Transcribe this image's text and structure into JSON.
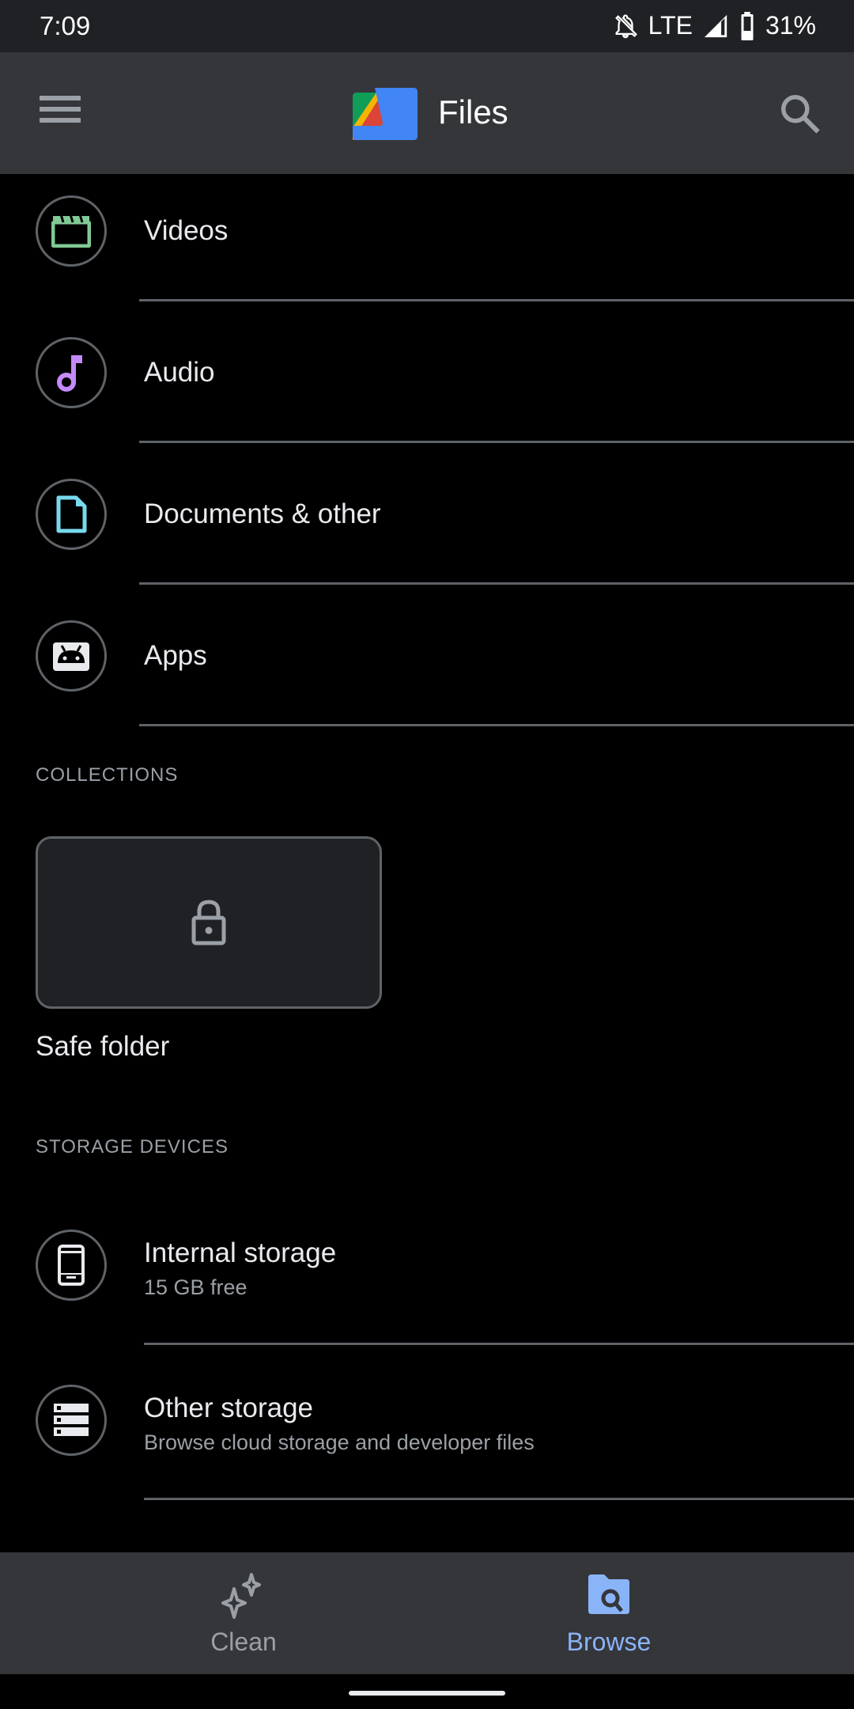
{
  "status_bar": {
    "time": "7:09",
    "network": "LTE",
    "battery": "31%"
  },
  "app_bar": {
    "title": "Files"
  },
  "categories": [
    {
      "label": "Videos",
      "icon": "video-clapper-icon",
      "color": "#81c995"
    },
    {
      "label": "Audio",
      "icon": "music-note-icon",
      "color": "#c58af9"
    },
    {
      "label": "Documents & other",
      "icon": "document-icon",
      "color": "#78d9ec"
    },
    {
      "label": "Apps",
      "icon": "android-icon",
      "color": "#e8eaed"
    }
  ],
  "collections": {
    "header": "COLLECTIONS",
    "items": [
      {
        "label": "Safe folder",
        "icon": "lock-icon"
      }
    ]
  },
  "storage": {
    "header": "STORAGE DEVICES",
    "items": [
      {
        "label": "Internal storage",
        "subtitle": "15 GB free",
        "icon": "phone-icon"
      },
      {
        "label": "Other storage",
        "subtitle": "Browse cloud storage and developer files",
        "icon": "storage-icon"
      }
    ]
  },
  "bottom_nav": {
    "tabs": [
      {
        "label": "Clean",
        "icon": "sparkle-icon",
        "active": false,
        "color": "#9aa0a6"
      },
      {
        "label": "Browse",
        "icon": "folder-search-icon",
        "active": true,
        "color": "#8ab4f8"
      }
    ]
  }
}
